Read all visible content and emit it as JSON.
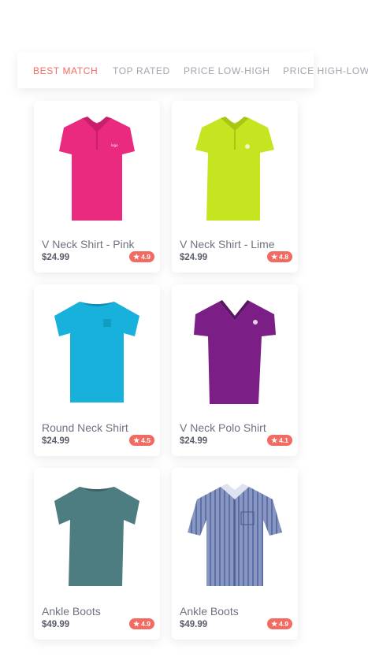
{
  "sort_tabs": [
    {
      "label": "BEST MATCH",
      "active": true
    },
    {
      "label": "TOP RATED",
      "active": false
    },
    {
      "label": "PRICE LOW-HIGH",
      "active": false
    },
    {
      "label": "PRICE HIGH-LOW",
      "active": false
    }
  ],
  "products": [
    {
      "name": "V Neck Shirt - Pink",
      "price": "$24.99",
      "rating": "4.9",
      "color": "#ea2a7e",
      "icon": "polo-shirt-icon"
    },
    {
      "name": "V Neck Shirt - Lime",
      "price": "$24.99",
      "rating": "4.8",
      "color": "#c6e41f",
      "icon": "polo-shirt-icon"
    },
    {
      "name": "Round Neck Shirt",
      "price": "$24.99",
      "rating": "4.5",
      "color": "#18b1dc",
      "icon": "tshirt-icon"
    },
    {
      "name": "V Neck Polo Shirt",
      "price": "$24.99",
      "rating": "4.1",
      "color": "#7b1f86",
      "icon": "vneck-shirt-icon"
    },
    {
      "name": "Ankle Boots",
      "price": "$49.99",
      "rating": "4.9",
      "color": "#4d7d80",
      "icon": "tshirt-icon"
    },
    {
      "name": "Ankle Boots",
      "price": "$49.99",
      "rating": "4.9",
      "color": "#7f8fbc",
      "icon": "button-shirt-icon"
    }
  ],
  "rating_icon": "star-icon",
  "accent_color": "#f26b63"
}
